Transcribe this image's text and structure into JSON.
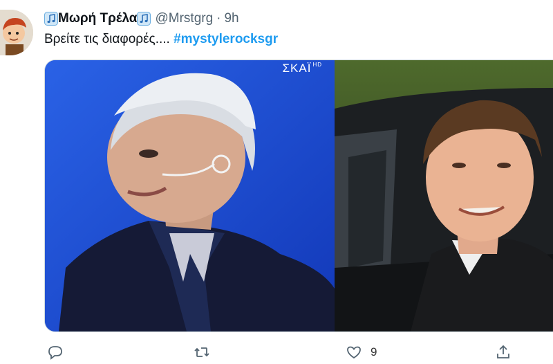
{
  "tweet": {
    "display_name": "Μωρή Τρέλα",
    "handle": "@Mrstgrg",
    "separator": "·",
    "time": "9h",
    "text": "Βρείτε τις διαφορές....",
    "hashtag": "#mystylerocksgr",
    "media": {
      "left_logo": "ΣΚΑΪ",
      "left_logo_suffix": "HD"
    },
    "actions": {
      "reply_icon": "reply-icon",
      "retweet_icon": "retweet-icon",
      "like_icon": "heart-icon",
      "like_count": "9",
      "share_icon": "share-icon"
    }
  },
  "colors": {
    "hashtag": "#1d9bf0",
    "secondary_text": "#536471",
    "left_photo_background": "#1f4fd8"
  }
}
